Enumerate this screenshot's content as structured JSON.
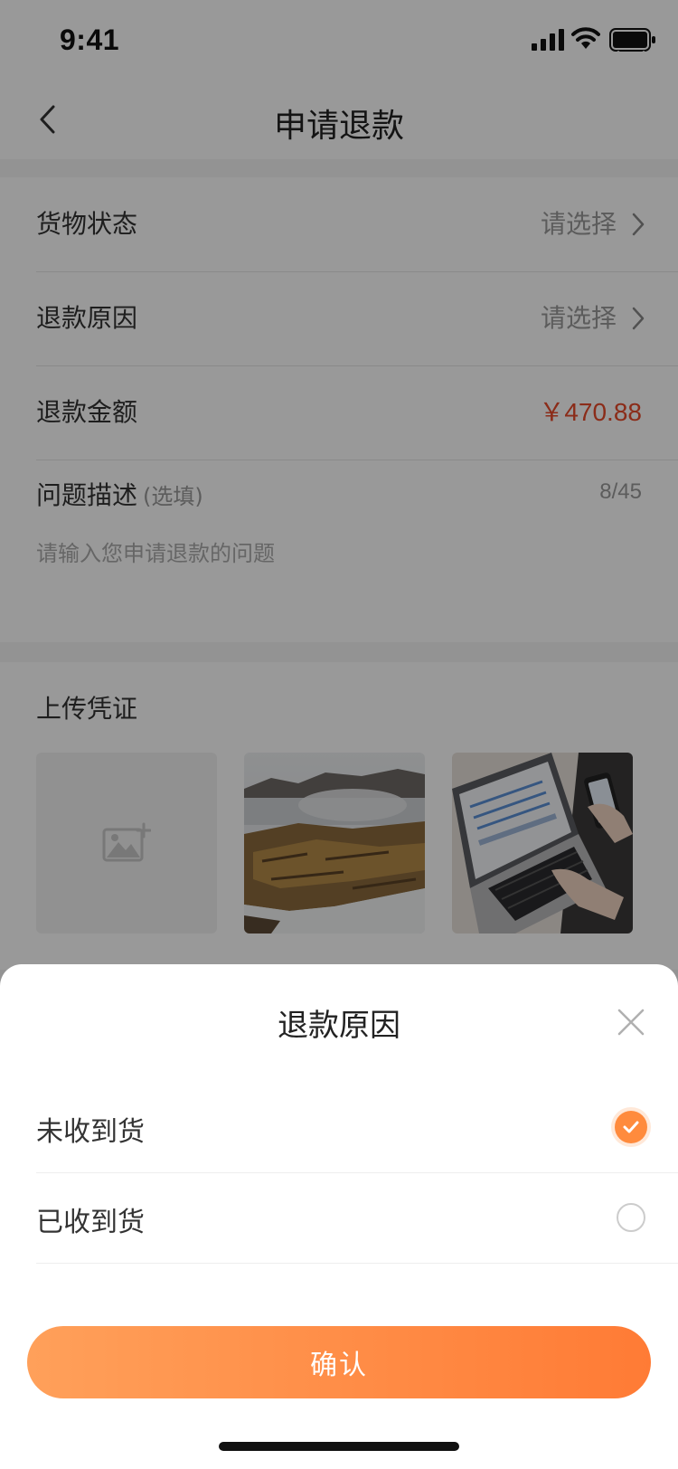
{
  "status_bar": {
    "time": "9:41",
    "icons": [
      "signal-icon",
      "wifi-icon",
      "battery-icon"
    ]
  },
  "nav": {
    "title": "申请退款",
    "back_icon": "chevron-left-icon",
    "close_icon": "close-icon"
  },
  "form": {
    "goods_status": {
      "label": "货物状态",
      "value": "请选择"
    },
    "refund_reason": {
      "label": "退款原因",
      "value": "请选择"
    },
    "refund_amount": {
      "label": "退款金额",
      "value": "￥470.88"
    },
    "description": {
      "label": "问题描述",
      "optional": "(选填)",
      "count": "8/45",
      "placeholder": "请输入您申请退款的问题"
    }
  },
  "upload": {
    "title": "上传凭证",
    "add_icon": "add-image-icon",
    "thumbnails": [
      "geyser-photo",
      "laptop-photo"
    ]
  },
  "sheet": {
    "title": "退款原因",
    "close_icon": "close-icon",
    "options": [
      {
        "label": "未收到货",
        "selected": true
      },
      {
        "label": "已收到货",
        "selected": false
      }
    ],
    "confirm_label": "确认"
  },
  "colors": {
    "accent": "#ff8b3d",
    "amount": "#e84a2a",
    "button_gradient_start": "#ffa05a",
    "button_gradient_end": "#ff7b35"
  }
}
